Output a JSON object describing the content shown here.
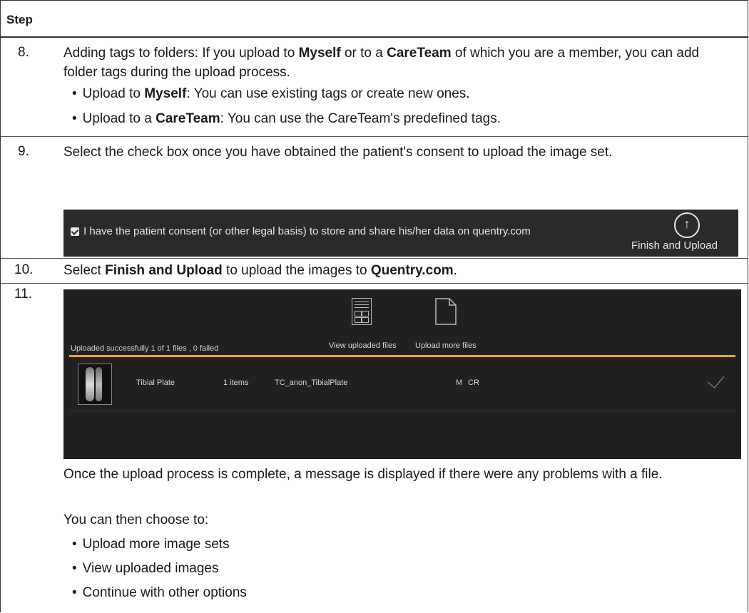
{
  "header": {
    "step_label": "Step"
  },
  "step8": {
    "number": "8.",
    "intro": {
      "a": "Adding tags to folders: If you upload to ",
      "b": "Myself",
      "c": " or to a ",
      "d": "CareTeam",
      "e": " of which you are a member, you can add folder tags during the upload process."
    },
    "bullets": [
      {
        "a": "Upload to ",
        "b": "Myself",
        "c": ": You can use existing tags or create new ones."
      },
      {
        "a": "Upload to a ",
        "b": "CareTeam",
        "c": ": You can use the CareTeam's predefined tags."
      }
    ]
  },
  "step9": {
    "number": "9.",
    "text": "Select the check box once you have obtained the patient's consent to upload the image set.",
    "consent_text": "I have the patient consent (or other legal basis) to store and share his/her data on quentry.com",
    "finish_label": "Finish and Upload",
    "arrow_glyph": "↑"
  },
  "step10": {
    "number": "10.",
    "a": "Select ",
    "b": "Finish and Upload",
    "c": " to upload the images to ",
    "d": "Quentry.com",
    "e": "."
  },
  "step11": {
    "number": "11.",
    "panel": {
      "status": "Uploaded successfully 1 of 1 files , 0 failed",
      "view_label": "View uploaded files",
      "more_label": "Upload more files",
      "accent_color": "#f0a500",
      "row": {
        "name": "Tibial Plate",
        "items": "1 items",
        "file": "TC_anon_TibialPlate",
        "sex": "M",
        "modality": "CR"
      }
    },
    "text1": "Once the upload process is complete, a message is displayed if there were any problems with a file.",
    "text2": "You can then choose to:",
    "options": [
      "Upload more image sets",
      "View uploaded images",
      "Continue with other options"
    ]
  }
}
